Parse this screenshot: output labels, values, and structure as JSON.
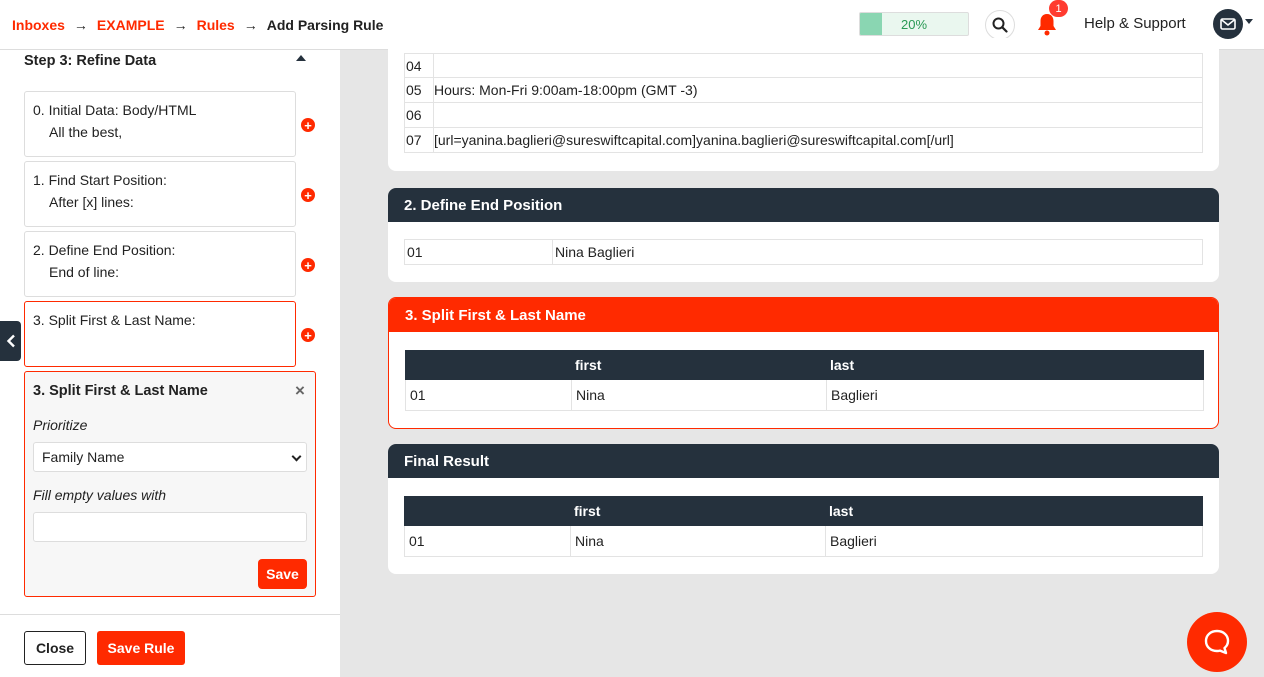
{
  "header": {
    "breadcrumb": [
      {
        "label": "Inboxes"
      },
      {
        "label": "EXAMPLE"
      },
      {
        "label": "Rules"
      }
    ],
    "current": "Add Parsing Rule",
    "progress": {
      "percent": 20,
      "label": "20%"
    },
    "notifications_count": "1",
    "help_label": "Help & Support"
  },
  "sidebar": {
    "title": "Step 3: Refine Data",
    "steps": [
      {
        "line1": "0. Initial Data: Body/HTML",
        "line2": "All the best,"
      },
      {
        "line1": "1. Find Start Position:",
        "line2": "After [x] lines:"
      },
      {
        "line1": "2. Define End Position:",
        "line2": "End of line:"
      },
      {
        "line1": "3. Split First & Last Name:",
        "line2": ""
      }
    ],
    "edit_panel": {
      "title": "3. Split First & Last Name",
      "prioritize_label": "Prioritize",
      "prioritize_value": "Family Name",
      "fill_label": "Fill empty values with",
      "fill_value": "",
      "save_label": "Save"
    },
    "close_label": "Close",
    "save_rule_label": "Save Rule"
  },
  "main": {
    "initial_rows": [
      {
        "num": "04",
        "text": ""
      },
      {
        "num": "05",
        "text": "Hours: Mon-Fri 9:00am-18:00pm (GMT -3)"
      },
      {
        "num": "06",
        "text": ""
      },
      {
        "num": "07",
        "text": "[url=yanina.baglieri@sureswiftcapital.com]yanina.baglieri@sureswiftcapital.com[/url]"
      }
    ],
    "end_position": {
      "title": "2. Define End Position",
      "rows": [
        {
          "num": "01",
          "text": "Nina Baglieri"
        }
      ]
    },
    "split": {
      "title": "3. Split First & Last Name",
      "columns": [
        "",
        "first",
        "last"
      ],
      "rows": [
        {
          "num": "01",
          "first": "Nina",
          "last": "Baglieri"
        }
      ]
    },
    "final": {
      "title": "Final Result",
      "columns": [
        "",
        "first",
        "last"
      ],
      "rows": [
        {
          "num": "01",
          "first": "Nina",
          "last": "Baglieri"
        }
      ]
    }
  }
}
